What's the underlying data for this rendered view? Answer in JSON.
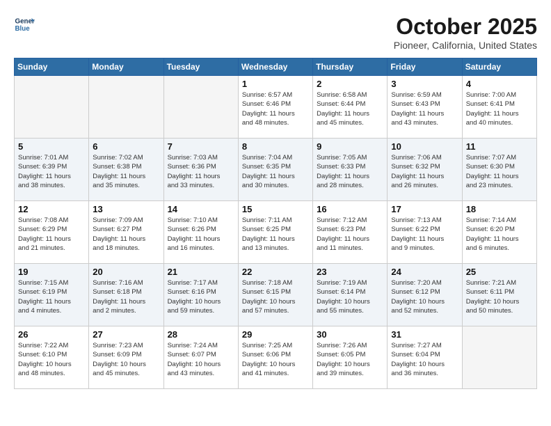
{
  "header": {
    "logo_line1": "General",
    "logo_line2": "Blue",
    "month": "October 2025",
    "location": "Pioneer, California, United States"
  },
  "days_of_week": [
    "Sunday",
    "Monday",
    "Tuesday",
    "Wednesday",
    "Thursday",
    "Friday",
    "Saturday"
  ],
  "weeks": [
    [
      {
        "day": "",
        "info": ""
      },
      {
        "day": "",
        "info": ""
      },
      {
        "day": "",
        "info": ""
      },
      {
        "day": "1",
        "info": "Sunrise: 6:57 AM\nSunset: 6:46 PM\nDaylight: 11 hours\nand 48 minutes."
      },
      {
        "day": "2",
        "info": "Sunrise: 6:58 AM\nSunset: 6:44 PM\nDaylight: 11 hours\nand 45 minutes."
      },
      {
        "day": "3",
        "info": "Sunrise: 6:59 AM\nSunset: 6:43 PM\nDaylight: 11 hours\nand 43 minutes."
      },
      {
        "day": "4",
        "info": "Sunrise: 7:00 AM\nSunset: 6:41 PM\nDaylight: 11 hours\nand 40 minutes."
      }
    ],
    [
      {
        "day": "5",
        "info": "Sunrise: 7:01 AM\nSunset: 6:39 PM\nDaylight: 11 hours\nand 38 minutes."
      },
      {
        "day": "6",
        "info": "Sunrise: 7:02 AM\nSunset: 6:38 PM\nDaylight: 11 hours\nand 35 minutes."
      },
      {
        "day": "7",
        "info": "Sunrise: 7:03 AM\nSunset: 6:36 PM\nDaylight: 11 hours\nand 33 minutes."
      },
      {
        "day": "8",
        "info": "Sunrise: 7:04 AM\nSunset: 6:35 PM\nDaylight: 11 hours\nand 30 minutes."
      },
      {
        "day": "9",
        "info": "Sunrise: 7:05 AM\nSunset: 6:33 PM\nDaylight: 11 hours\nand 28 minutes."
      },
      {
        "day": "10",
        "info": "Sunrise: 7:06 AM\nSunset: 6:32 PM\nDaylight: 11 hours\nand 26 minutes."
      },
      {
        "day": "11",
        "info": "Sunrise: 7:07 AM\nSunset: 6:30 PM\nDaylight: 11 hours\nand 23 minutes."
      }
    ],
    [
      {
        "day": "12",
        "info": "Sunrise: 7:08 AM\nSunset: 6:29 PM\nDaylight: 11 hours\nand 21 minutes."
      },
      {
        "day": "13",
        "info": "Sunrise: 7:09 AM\nSunset: 6:27 PM\nDaylight: 11 hours\nand 18 minutes."
      },
      {
        "day": "14",
        "info": "Sunrise: 7:10 AM\nSunset: 6:26 PM\nDaylight: 11 hours\nand 16 minutes."
      },
      {
        "day": "15",
        "info": "Sunrise: 7:11 AM\nSunset: 6:25 PM\nDaylight: 11 hours\nand 13 minutes."
      },
      {
        "day": "16",
        "info": "Sunrise: 7:12 AM\nSunset: 6:23 PM\nDaylight: 11 hours\nand 11 minutes."
      },
      {
        "day": "17",
        "info": "Sunrise: 7:13 AM\nSunset: 6:22 PM\nDaylight: 11 hours\nand 9 minutes."
      },
      {
        "day": "18",
        "info": "Sunrise: 7:14 AM\nSunset: 6:20 PM\nDaylight: 11 hours\nand 6 minutes."
      }
    ],
    [
      {
        "day": "19",
        "info": "Sunrise: 7:15 AM\nSunset: 6:19 PM\nDaylight: 11 hours\nand 4 minutes."
      },
      {
        "day": "20",
        "info": "Sunrise: 7:16 AM\nSunset: 6:18 PM\nDaylight: 11 hours\nand 2 minutes."
      },
      {
        "day": "21",
        "info": "Sunrise: 7:17 AM\nSunset: 6:16 PM\nDaylight: 10 hours\nand 59 minutes."
      },
      {
        "day": "22",
        "info": "Sunrise: 7:18 AM\nSunset: 6:15 PM\nDaylight: 10 hours\nand 57 minutes."
      },
      {
        "day": "23",
        "info": "Sunrise: 7:19 AM\nSunset: 6:14 PM\nDaylight: 10 hours\nand 55 minutes."
      },
      {
        "day": "24",
        "info": "Sunrise: 7:20 AM\nSunset: 6:12 PM\nDaylight: 10 hours\nand 52 minutes."
      },
      {
        "day": "25",
        "info": "Sunrise: 7:21 AM\nSunset: 6:11 PM\nDaylight: 10 hours\nand 50 minutes."
      }
    ],
    [
      {
        "day": "26",
        "info": "Sunrise: 7:22 AM\nSunset: 6:10 PM\nDaylight: 10 hours\nand 48 minutes."
      },
      {
        "day": "27",
        "info": "Sunrise: 7:23 AM\nSunset: 6:09 PM\nDaylight: 10 hours\nand 45 minutes."
      },
      {
        "day": "28",
        "info": "Sunrise: 7:24 AM\nSunset: 6:07 PM\nDaylight: 10 hours\nand 43 minutes."
      },
      {
        "day": "29",
        "info": "Sunrise: 7:25 AM\nSunset: 6:06 PM\nDaylight: 10 hours\nand 41 minutes."
      },
      {
        "day": "30",
        "info": "Sunrise: 7:26 AM\nSunset: 6:05 PM\nDaylight: 10 hours\nand 39 minutes."
      },
      {
        "day": "31",
        "info": "Sunrise: 7:27 AM\nSunset: 6:04 PM\nDaylight: 10 hours\nand 36 minutes."
      },
      {
        "day": "",
        "info": ""
      }
    ]
  ]
}
